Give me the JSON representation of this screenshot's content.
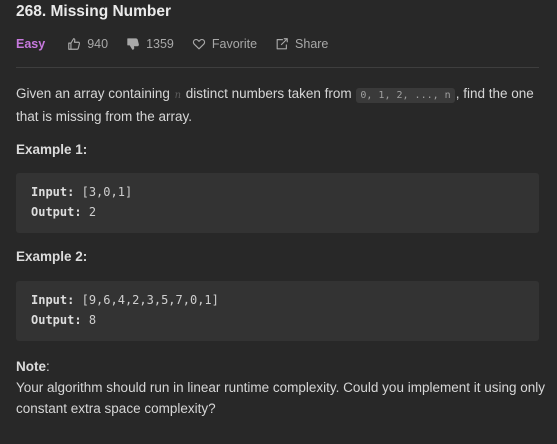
{
  "problem": {
    "title": "268. Missing Number",
    "difficulty": "Easy",
    "likes": "940",
    "dislikes": "1359",
    "favorite_label": "Favorite",
    "share_label": "Share"
  },
  "description": {
    "p1_before": "Given an array containing ",
    "n_var": "n",
    "p1_mid": " distinct numbers taken from ",
    "seq": "0, 1, 2, ..., n",
    "p1_after": ", find the one that is missing from the array."
  },
  "examples": [
    {
      "label": "Example 1:",
      "input_key": "Input:",
      "input_value": "[3,0,1]",
      "output_key": "Output:",
      "output_value": "2"
    },
    {
      "label": "Example 2:",
      "input_key": "Input:",
      "input_value": "[9,6,4,2,3,5,7,0,1]",
      "output_key": "Output:",
      "output_value": "8"
    }
  ],
  "note": {
    "label": "Note",
    "colon": ":",
    "text": "Your algorithm should run in linear runtime complexity. Could you implement it using only constant extra space complexity?"
  },
  "colors": {
    "background": "#282828",
    "difficulty_easy": "#c678dd",
    "code_background": "#333333"
  },
  "icons": {
    "like": "thumbs-up-icon",
    "dislike": "thumbs-down-icon",
    "favorite": "heart-icon",
    "share": "share-icon"
  }
}
